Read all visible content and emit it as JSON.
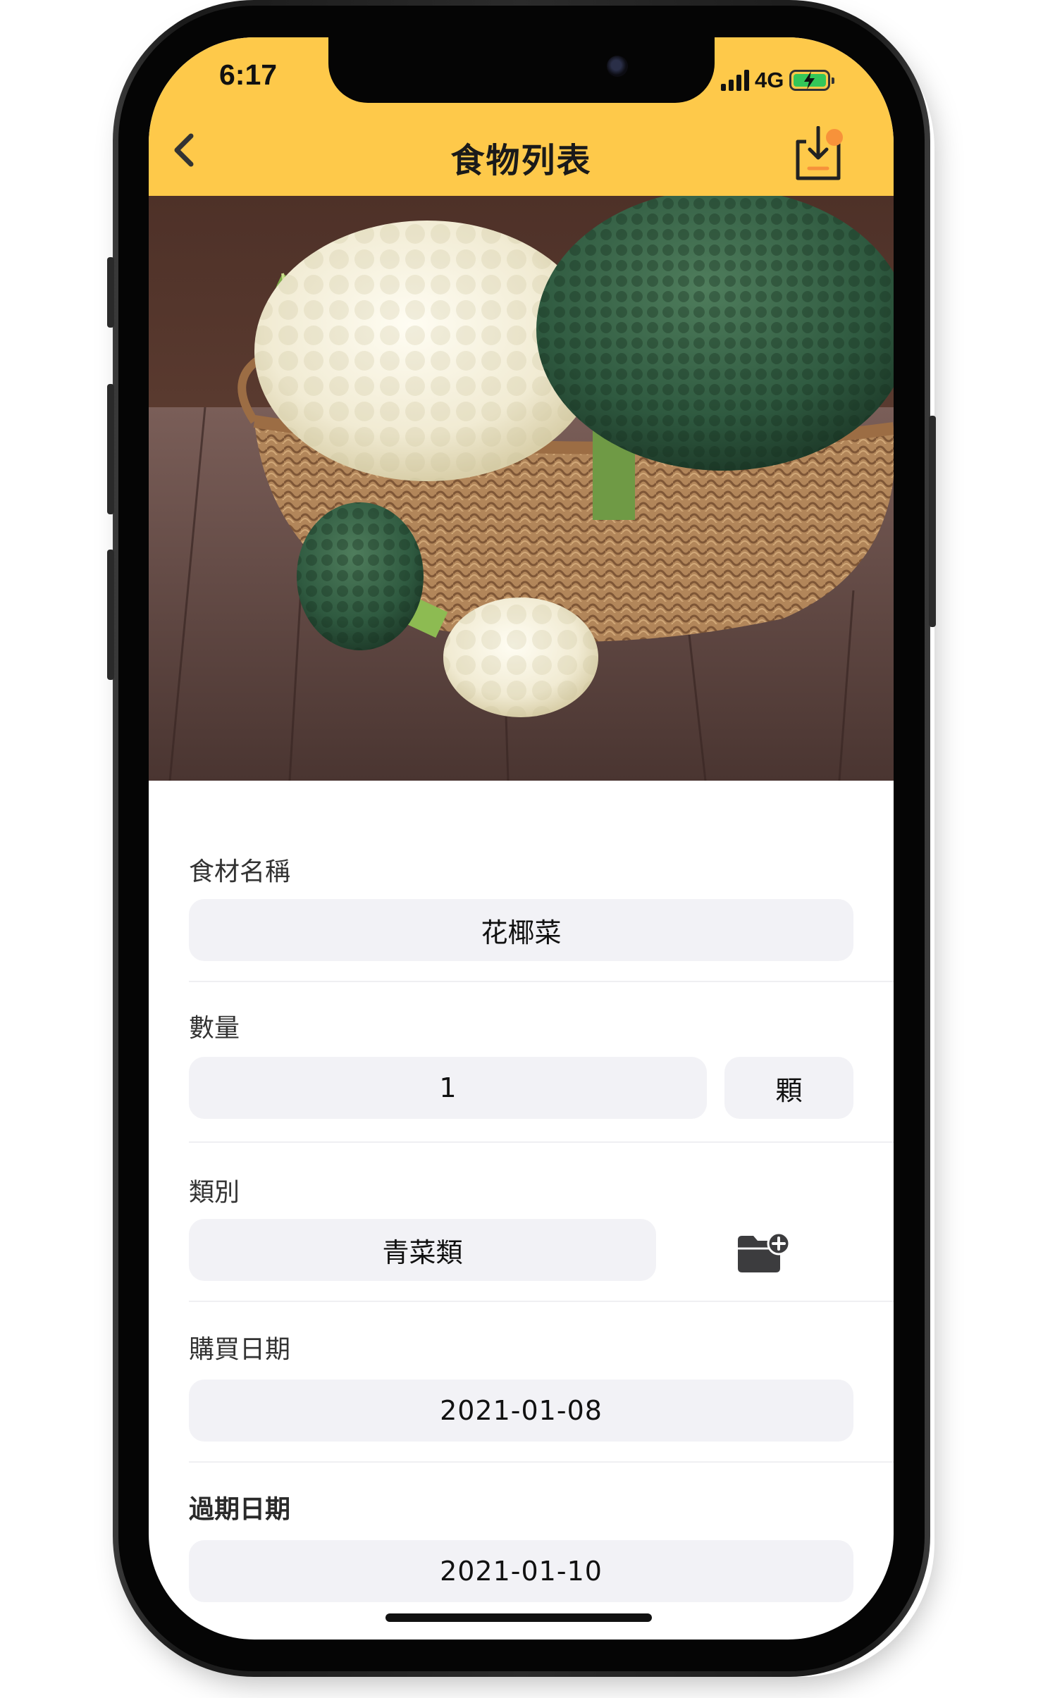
{
  "status_bar": {
    "time": "6:17",
    "network": "4G",
    "battery_icon": "battery-charging-icon",
    "signal_icon": "cellular-signal-icon"
  },
  "nav": {
    "title": "食物列表",
    "back_icon": "chevron-left-icon",
    "action_icon": "download-tray-icon",
    "accent_color": "#fec94a",
    "badge_color": "#f7923a"
  },
  "photo": {
    "subject_icon": "cauliflower-broccoli-basket-photo"
  },
  "form": {
    "name": {
      "label": "食材名稱",
      "value": "花椰菜"
    },
    "quantity": {
      "label": "數量",
      "value": "1",
      "unit": "顆"
    },
    "category": {
      "label": "類別",
      "value": "青菜類",
      "add_icon": "folder-add-icon"
    },
    "purchase_date": {
      "label": "購買日期",
      "value": "2021-01-08"
    },
    "expiry_date": {
      "label": "過期日期",
      "value": "2021-01-10"
    }
  }
}
